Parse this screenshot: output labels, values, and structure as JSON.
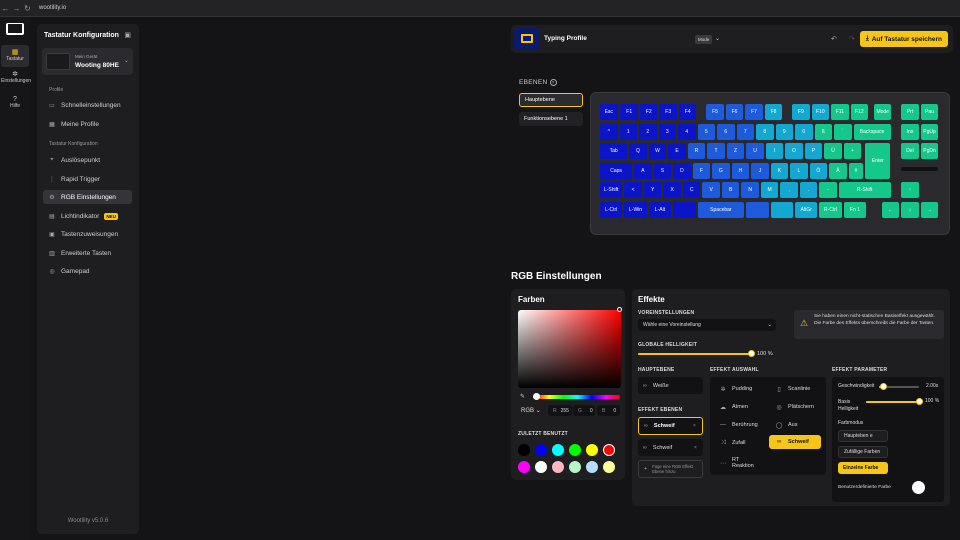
{
  "browser": {
    "url": "wootility.io"
  },
  "rail": {
    "items": [
      {
        "label": "Tastatur",
        "icon": "keyboard-icon"
      },
      {
        "label": "Einstellungen",
        "icon": "gear-icon"
      },
      {
        "label": "Hilfe",
        "icon": "help-icon"
      }
    ]
  },
  "sidebar": {
    "title": "Tastatur Konfiguration",
    "device_label": "Mein Gerät",
    "device_name": "Wooting 80HE",
    "section_profiles": "Profile",
    "section_config": "Tastatur Konfiguration",
    "items": [
      {
        "label": "Schnelleinstellungen"
      },
      {
        "label": "Meine Profile"
      },
      {
        "label": "Auslösepunkt"
      },
      {
        "label": "Rapid Trigger"
      },
      {
        "label": "RGB Einstellungen"
      },
      {
        "label": "Lichtindikator",
        "badge": "NEU"
      },
      {
        "label": "Tastenzuweisungen"
      },
      {
        "label": "Erweiterte Tasten"
      },
      {
        "label": "Gamepad"
      }
    ],
    "version": "Wootility v5.0.6"
  },
  "topbar": {
    "profile_name": "Typing Profile",
    "mode_badge": "Mode",
    "save_label": "Auf Tastatur speichern"
  },
  "layers": {
    "title": "EBENEN",
    "items": [
      {
        "label": "Hauptebene"
      },
      {
        "label": "Funktionsebene 1"
      }
    ]
  },
  "keyboard": {
    "rows": [
      [
        "Esc",
        "F1",
        "F2",
        "F3",
        "F4",
        "F5",
        "F6",
        "F7",
        "F8",
        "F9",
        "F10",
        "F11",
        "F12",
        "Mode",
        "Prt",
        "Pau"
      ],
      [
        "^",
        "1",
        "2",
        "3",
        "4",
        "5",
        "6",
        "7",
        "8",
        "9",
        "0",
        "ß",
        "´",
        "Backspace",
        "Ins",
        "PgUp"
      ],
      [
        "Tab",
        "Q",
        "W",
        "E",
        "R",
        "T",
        "Z",
        "U",
        "I",
        "O",
        "P",
        "Ü",
        "+",
        "Enter",
        "Del",
        "PgDn"
      ],
      [
        "Caps",
        "A",
        "S",
        "D",
        "F",
        "G",
        "H",
        "J",
        "K",
        "L",
        "Ö",
        "Ä",
        "#"
      ],
      [
        "L-Shift",
        "<",
        "Y",
        "X",
        "C",
        "V",
        "B",
        "N",
        "M",
        ",",
        ".",
        "-",
        "R-Shift",
        "↑"
      ],
      [
        "L-Ctrl",
        "L-Win",
        "L-Alt",
        "",
        "Spacebar",
        "",
        "",
        "AltGr",
        "R-Ctrl",
        "Fn 1",
        "←",
        "↓",
        "→"
      ]
    ]
  },
  "rgb": {
    "title": "RGB Einstellungen",
    "colors": {
      "title": "Farben",
      "mode": "RGB",
      "r_label": "R",
      "r": "255",
      "g_label": "G",
      "g": "0",
      "b_label": "B",
      "b": "0",
      "recent_title": "ZULETZT BENUTZT",
      "recent": [
        "#000000",
        "#0000ff",
        "#00ffff",
        "#00ff00",
        "#ffff00",
        "#ff0000",
        "#ff00ff",
        "#ffffff",
        "#ffb6c1",
        "#b6f5c8",
        "#b6dcff",
        "#ffff99"
      ]
    },
    "effects": {
      "title": "Effekte",
      "presets_label": "VOREINSTELLUNGEN",
      "presets_placeholder": "Wähle eine Voreinstellung",
      "brightness_label": "GLOBALE HELLIGKEIT",
      "brightness_value": "100 %",
      "brightness": 1.0,
      "warning": "Sie haben einen nicht-statischen Basiseffekt ausgewählt. Die Farbe des Effekts überschreibt die Farbe der Tasten.",
      "main_layer_label": "HAUPTEBENE",
      "main_layer_value": "Weiße",
      "effect_layers_label": "EFFEKT EBENEN",
      "effect_layers": [
        {
          "label": "Schweif"
        },
        {
          "label": "Schweif"
        }
      ],
      "add_layer": "Füge eine RGB Effekt Ebene hinzu",
      "selection_label": "EFFEKT AUSWAHL",
      "selection": [
        {
          "label": "Pudding",
          "icon": "pudding-icon"
        },
        {
          "label": "Scanlinie",
          "icon": "scanline-icon"
        },
        {
          "label": "Atmen",
          "icon": "breathe-icon"
        },
        {
          "label": "Plätschern",
          "icon": "ripple-icon"
        },
        {
          "label": "Berührung",
          "icon": "touch-icon"
        },
        {
          "label": "Aus",
          "icon": "off-icon"
        },
        {
          "label": "Zufall",
          "icon": "random-icon"
        },
        {
          "label": "Schweif",
          "icon": "trail-icon"
        },
        {
          "label": "RT Reaktion",
          "icon": "rt-reaction-icon"
        }
      ],
      "params_label": "EFFEKT PARAMETER",
      "speed_label": "Geschwindigkeit",
      "speed_value": "2.00s",
      "speed": 0.12,
      "basis_brightness_label": "Basis Helligkeit",
      "basis_brightness_value": "100 %",
      "basis_brightness": 1.0,
      "colormode_label": "Farbmodus",
      "colormode_options": [
        "Haupteben e",
        "Zufällige Farben",
        "Einzelne Farbe"
      ],
      "custom_color_label": "Benutzerdefinierte Farbe"
    }
  },
  "colors": {
    "accent": "#f5c518",
    "key_blue_dark": "#0a14c8",
    "key_blue": "#1e5adc",
    "key_cyan": "#12a8d2",
    "key_green": "#14c88c"
  }
}
